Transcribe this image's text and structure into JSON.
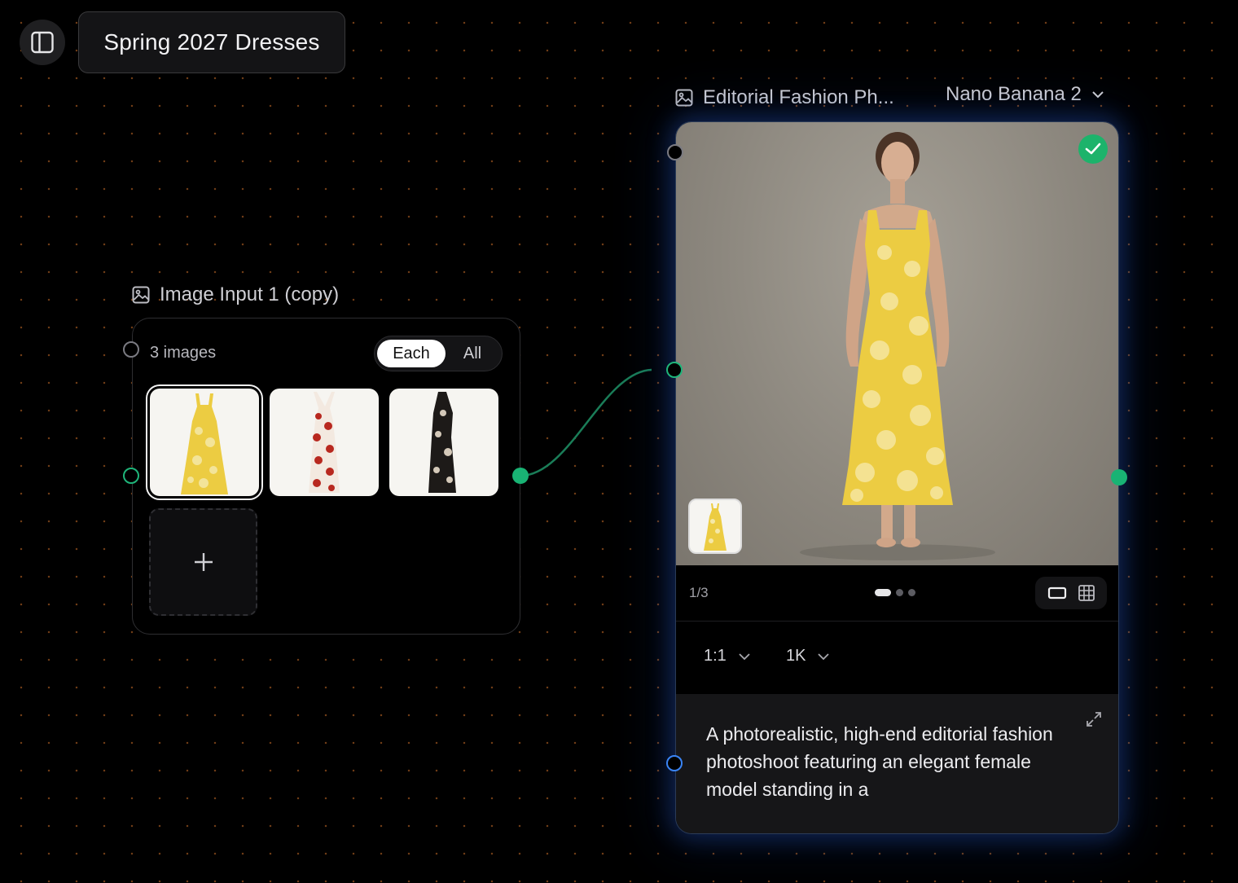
{
  "toolbar": {
    "project_title": "Spring 2027 Dresses"
  },
  "input_node": {
    "title": "Image Input 1 (copy)",
    "count_label": "3 images",
    "mode_options": [
      "Each",
      "All"
    ],
    "selected_mode": "Each",
    "images": [
      {
        "name": "yellow-floral-dress"
      },
      {
        "name": "red-floral-dress"
      },
      {
        "name": "black-floral-dress"
      }
    ],
    "add_label": "+"
  },
  "gen_node": {
    "title": "Editorial Fashion Ph...",
    "model": "Nano Banana 2",
    "status": "complete",
    "page_indicator": "1/3",
    "page_current": 1,
    "page_total": 3,
    "aspect_ratio": "1:1",
    "resolution": "1K",
    "prompt": "A photorealistic, high-end editorial fashion photoshoot featuring an elegant female model standing in a"
  },
  "colors": {
    "accent_green": "#19b374",
    "accent_blue": "#3a84f5",
    "glow_blue": "#2b5bd0",
    "dress_yellow": "#eccc42"
  }
}
